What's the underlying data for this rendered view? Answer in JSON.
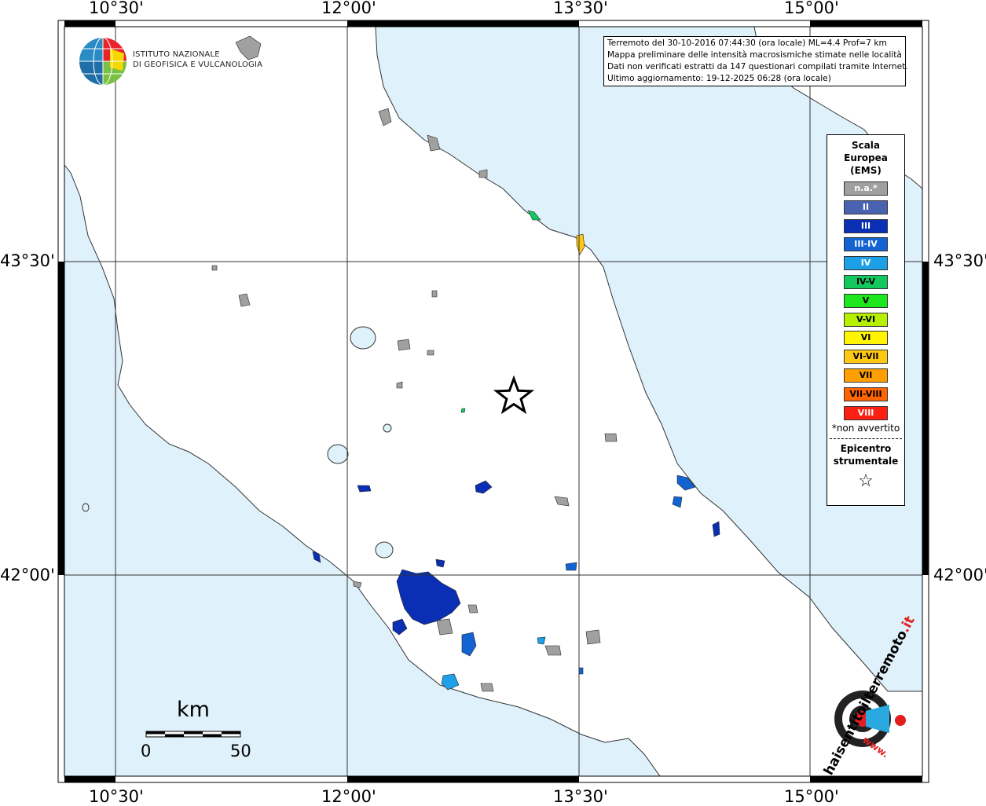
{
  "title_lines": [
    "Terremoto del 30-10-2016 07:44:30 (ora locale) ML=4.4 Prof=7 km",
    "Mappa preliminare delle intensità macrosismiche stimate nelle località",
    "Dati non verificati estratti da 147 questionari compilati tramite Internet.",
    "Ultimo aggiornamento: 19-12-2025 06:28 (ora locale)"
  ],
  "institute": {
    "line1": "ISTITUTO NAZIONALE",
    "line2": "DI GEOFISICA E VULCANOLOGIA"
  },
  "axes": {
    "lon_labels": [
      "10°30'",
      "12°00'",
      "13°30'",
      "15°00'"
    ],
    "lat_labels": [
      "43°30'",
      "42°00'"
    ]
  },
  "legend": {
    "title_lines": [
      "Scala",
      "Europea",
      "(EMS)"
    ],
    "items": [
      {
        "label": "n.a.*",
        "color": "#a0a0a0",
        "text_color": "#ffffff"
      },
      {
        "label": "II",
        "color": "#4a63b0",
        "text_color": "#ffffff"
      },
      {
        "label": "III",
        "color": "#0a2fb5",
        "text_color": "#ffffff"
      },
      {
        "label": "III-IV",
        "color": "#1463d2",
        "text_color": "#ffffff"
      },
      {
        "label": "IV",
        "color": "#1ea0e6",
        "text_color": "#ffffff"
      },
      {
        "label": "IV-V",
        "color": "#14c860",
        "text_color": "#000000"
      },
      {
        "label": "V",
        "color": "#1ee61e",
        "text_color": "#000000"
      },
      {
        "label": "V-VI",
        "color": "#b4f000",
        "text_color": "#000000"
      },
      {
        "label": "VI",
        "color": "#fff500",
        "text_color": "#000000"
      },
      {
        "label": "VI-VII",
        "color": "#ffc814",
        "text_color": "#000000"
      },
      {
        "label": "VII",
        "color": "#ffa000",
        "text_color": "#000000"
      },
      {
        "label": "VII-VIII",
        "color": "#ff6400",
        "text_color": "#000000"
      },
      {
        "label": "VIII",
        "color": "#ff1e14",
        "text_color": "#ffffff"
      }
    ],
    "note": "*non avvertito",
    "epicenter_lines": [
      "Epicentro",
      "strumentale"
    ],
    "epicenter_symbol": "☆"
  },
  "scale_bar": {
    "unit": "km",
    "start": "0",
    "end": "50"
  },
  "brand": {
    "text_main": "haisentitoilterremoto",
    "text_tld": ".it",
    "text_www": "www."
  },
  "colors": {
    "sea": "#dff1fb",
    "land": "#ffffff",
    "na": "#a0a0a0",
    "ii": "#4a63b0",
    "iii": "#0a2fb5",
    "iiiiv": "#1463d2",
    "iv": "#1ea0e6",
    "ivv": "#14c860",
    "vivii": "#ffc814"
  }
}
